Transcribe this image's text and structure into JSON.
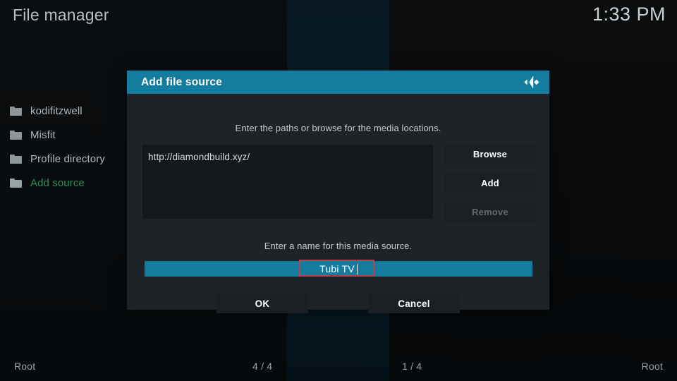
{
  "window": {
    "title": "File manager",
    "clock": "1:33 PM"
  },
  "sidebar": {
    "items": [
      {
        "label": "kodifitzwell",
        "icon": "folder-icon",
        "active": false
      },
      {
        "label": "Misfit",
        "icon": "folder-icon",
        "active": false
      },
      {
        "label": "Profile directory",
        "icon": "folder-icon",
        "active": false
      },
      {
        "label": "Add source",
        "icon": "folder-icon",
        "active": true
      }
    ]
  },
  "dialog": {
    "title": "Add file source",
    "logo_icon": "kodi-logo-icon",
    "path_hint": "Enter the paths or browse for the media locations.",
    "path_value": "http://diamondbuild.xyz/",
    "buttons": {
      "browse": "Browse",
      "add": "Add",
      "remove": "Remove"
    },
    "name_hint": "Enter a name for this media source.",
    "name_value": "Tubi TV",
    "footer": {
      "ok": "OK",
      "cancel": "Cancel"
    }
  },
  "statusbar": {
    "left": "Root",
    "count_left": "4 / 4",
    "count_right": "1 / 4",
    "right": "Root"
  },
  "colors": {
    "accent": "#147c9e",
    "dialog_bg": "#1d2326",
    "button_bg": "#191f22",
    "active_item": "#2f8f5b",
    "annotation": "#bf3f4b",
    "disabled_text": "#62686b"
  }
}
